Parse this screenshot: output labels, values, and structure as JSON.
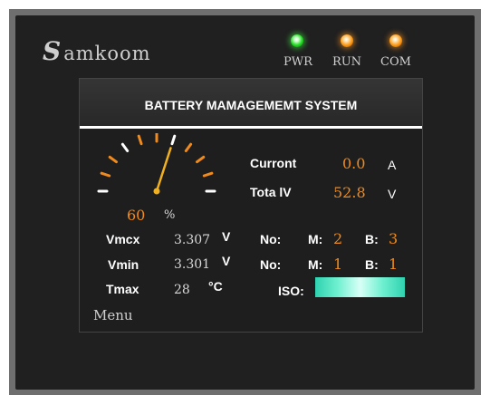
{
  "device": {
    "brand": "amkoom",
    "brand_initial": "S",
    "indicators": [
      {
        "label": "PWR",
        "color": "#22dd22"
      },
      {
        "label": "RUN",
        "color": "#ff9a14"
      },
      {
        "label": "COM",
        "color": "#ff9a14"
      }
    ]
  },
  "screen": {
    "title": "BATTERY MAMAGEMEMT SYSTEM",
    "gauge": {
      "value": "60",
      "unit": "%",
      "level": 0.6
    },
    "current": {
      "label": "Curront",
      "value": "0.0",
      "unit": "A"
    },
    "total_voltage": {
      "label": "Tota lV",
      "value": "52.8",
      "unit": "V"
    },
    "vmax": {
      "label": "Vmcx",
      "value": "3.307",
      "unit": "V",
      "no_label": "No:",
      "m_label": "M:",
      "m_value": "2",
      "b_label": "B:",
      "b_value": "3"
    },
    "vmin": {
      "label": "Vmin",
      "value": "3.301",
      "unit": "V",
      "no_label": "No:",
      "m_label": "M:",
      "m_value": "1",
      "b_label": "B:",
      "b_value": "1"
    },
    "tmax": {
      "label": "Tmax",
      "value": "28",
      "unit": "°C"
    },
    "iso": {
      "label": "ISO:"
    },
    "menu_label": "Menu"
  },
  "colors": {
    "accent": "#ee8a1e",
    "iso_bar": "#6ff0d0",
    "background": "#202020"
  }
}
